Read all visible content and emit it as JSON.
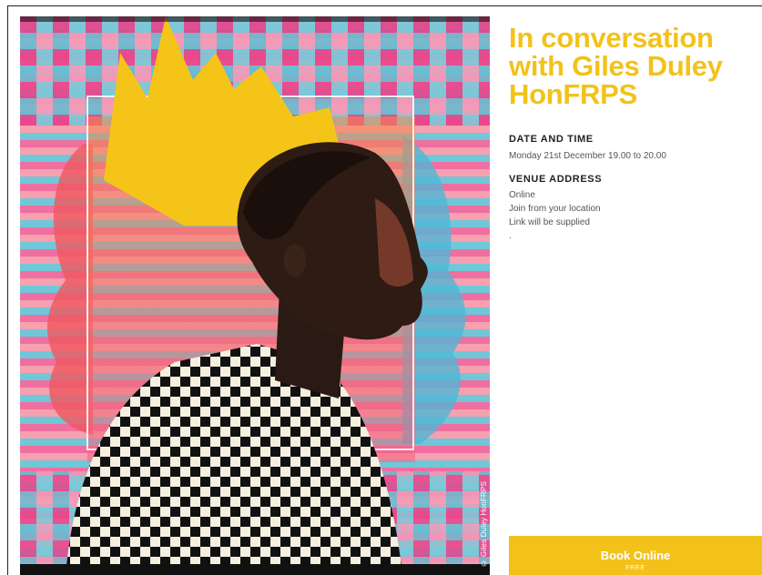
{
  "event": {
    "title_lines": [
      "In conversation",
      "with Giles Duley",
      "HonFRPS"
    ]
  },
  "date_time": {
    "heading": "DATE AND TIME",
    "value": "Monday 21st December 19.00 to 20.00"
  },
  "venue": {
    "heading": "VENUE ADDRESS",
    "lines": [
      "Online",
      "Join from your location",
      "Link will be supplied",
      "."
    ]
  },
  "booking": {
    "label": "Book Online",
    "price": "FREE"
  },
  "poster": {
    "credit": "© Giles Duley HonFRPS"
  },
  "colors": {
    "accent": "#f2c21b",
    "heading_text": "#222222",
    "body_text": "#555555"
  },
  "icons": {
    "crown": "crown-graphic",
    "portrait": "portrait-photo"
  }
}
